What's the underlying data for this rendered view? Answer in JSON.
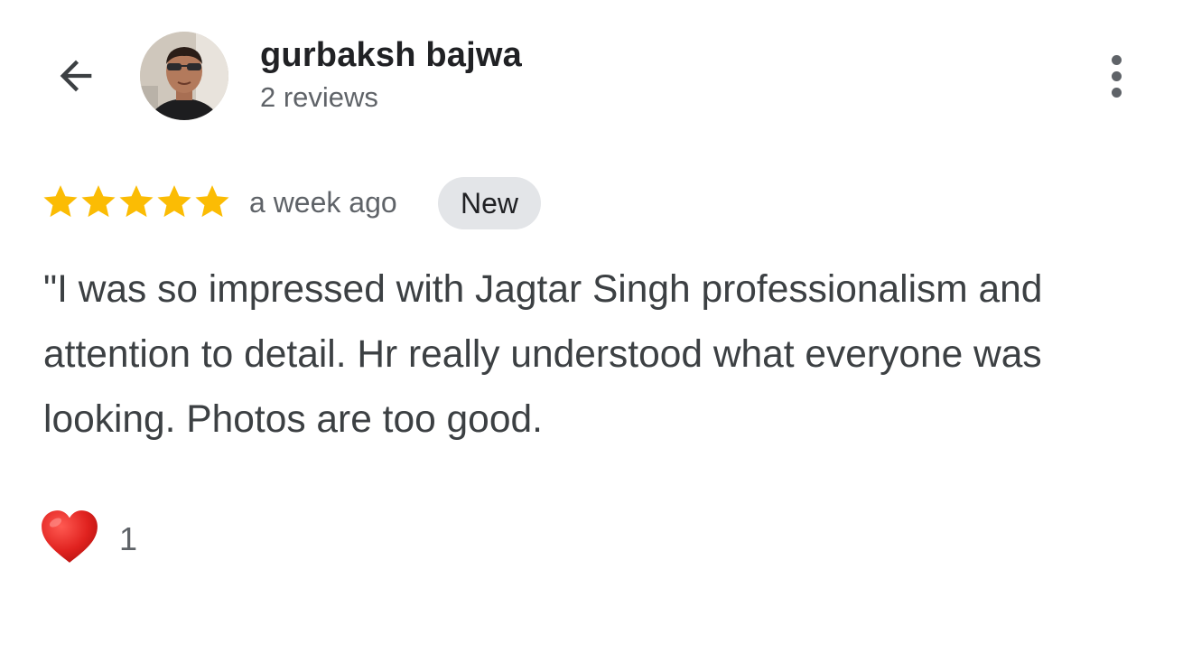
{
  "reviewer": {
    "name": "gurbaksh bajwa",
    "review_count": "2 reviews"
  },
  "review": {
    "rating": 5,
    "max_rating": 5,
    "time_ago": "a week ago",
    "badge": "New",
    "text": "\"I was so impressed with Jagtar Singh professionalism and attention to detail. Hr really understood what everyone was looking. Photos are too good.",
    "reaction_count": "1"
  },
  "colors": {
    "star": "#fbbc04",
    "heart": "#e0221f",
    "badge_bg": "#e3e5e8"
  },
  "icons": {
    "back": "arrow-left-icon",
    "more": "more-vert-icon",
    "reaction": "heart-icon"
  }
}
